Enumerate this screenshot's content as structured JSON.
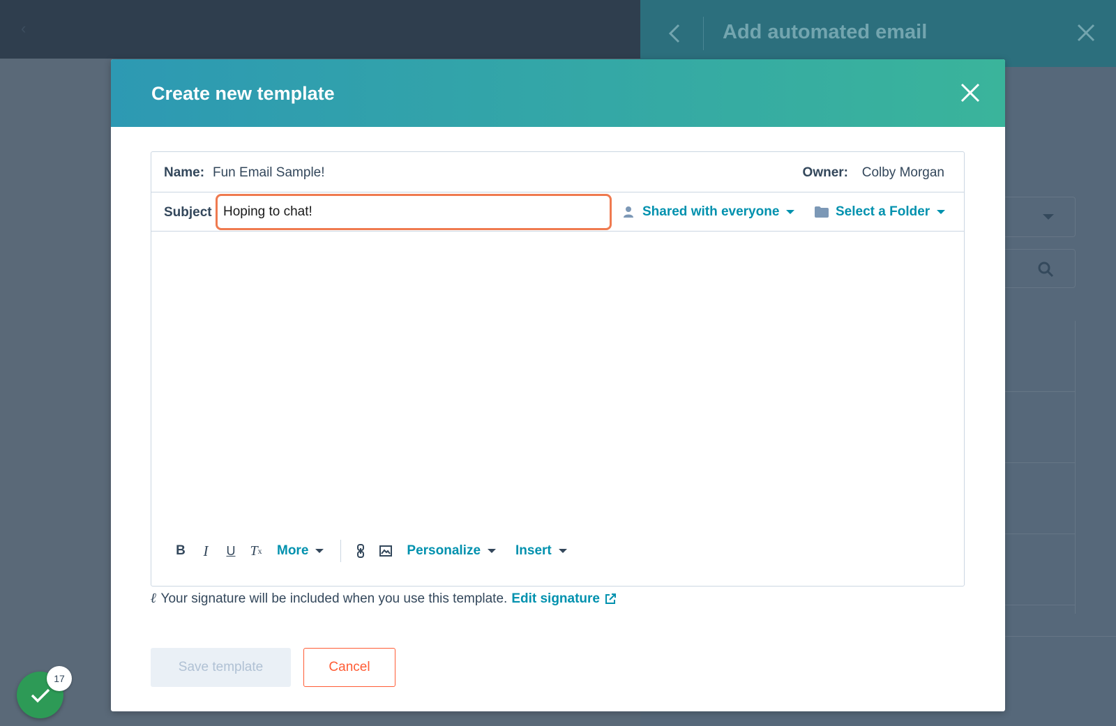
{
  "background": {
    "panel_title": "Add automated email"
  },
  "modal": {
    "title": "Create new template",
    "name_label": "Name:",
    "name_value": "Fun Email Sample!",
    "owner_label": "Owner:",
    "owner_value": "Colby Morgan",
    "subject_label": "Subject",
    "subject_value": "Hoping to chat!",
    "share_label": "Shared with everyone",
    "folder_label": "Select a Folder",
    "toolbar": {
      "bold": "B",
      "italic": "I",
      "underline": "U",
      "clear_format": "T",
      "more": "More",
      "personalize": "Personalize",
      "insert": "Insert"
    },
    "signature_text": "Your signature will be included when you use this template.",
    "edit_signature": "Edit signature",
    "save_button": "Save template",
    "cancel_button": "Cancel"
  },
  "notifications": {
    "count": "17"
  },
  "colors": {
    "accent_link": "#0091ae",
    "header_gradient_start": "#2d99b3",
    "header_gradient_end": "#3ab49b",
    "focus_border": "#ef7a4f",
    "cancel": "#ff5c35",
    "success": "#2d9a56"
  }
}
